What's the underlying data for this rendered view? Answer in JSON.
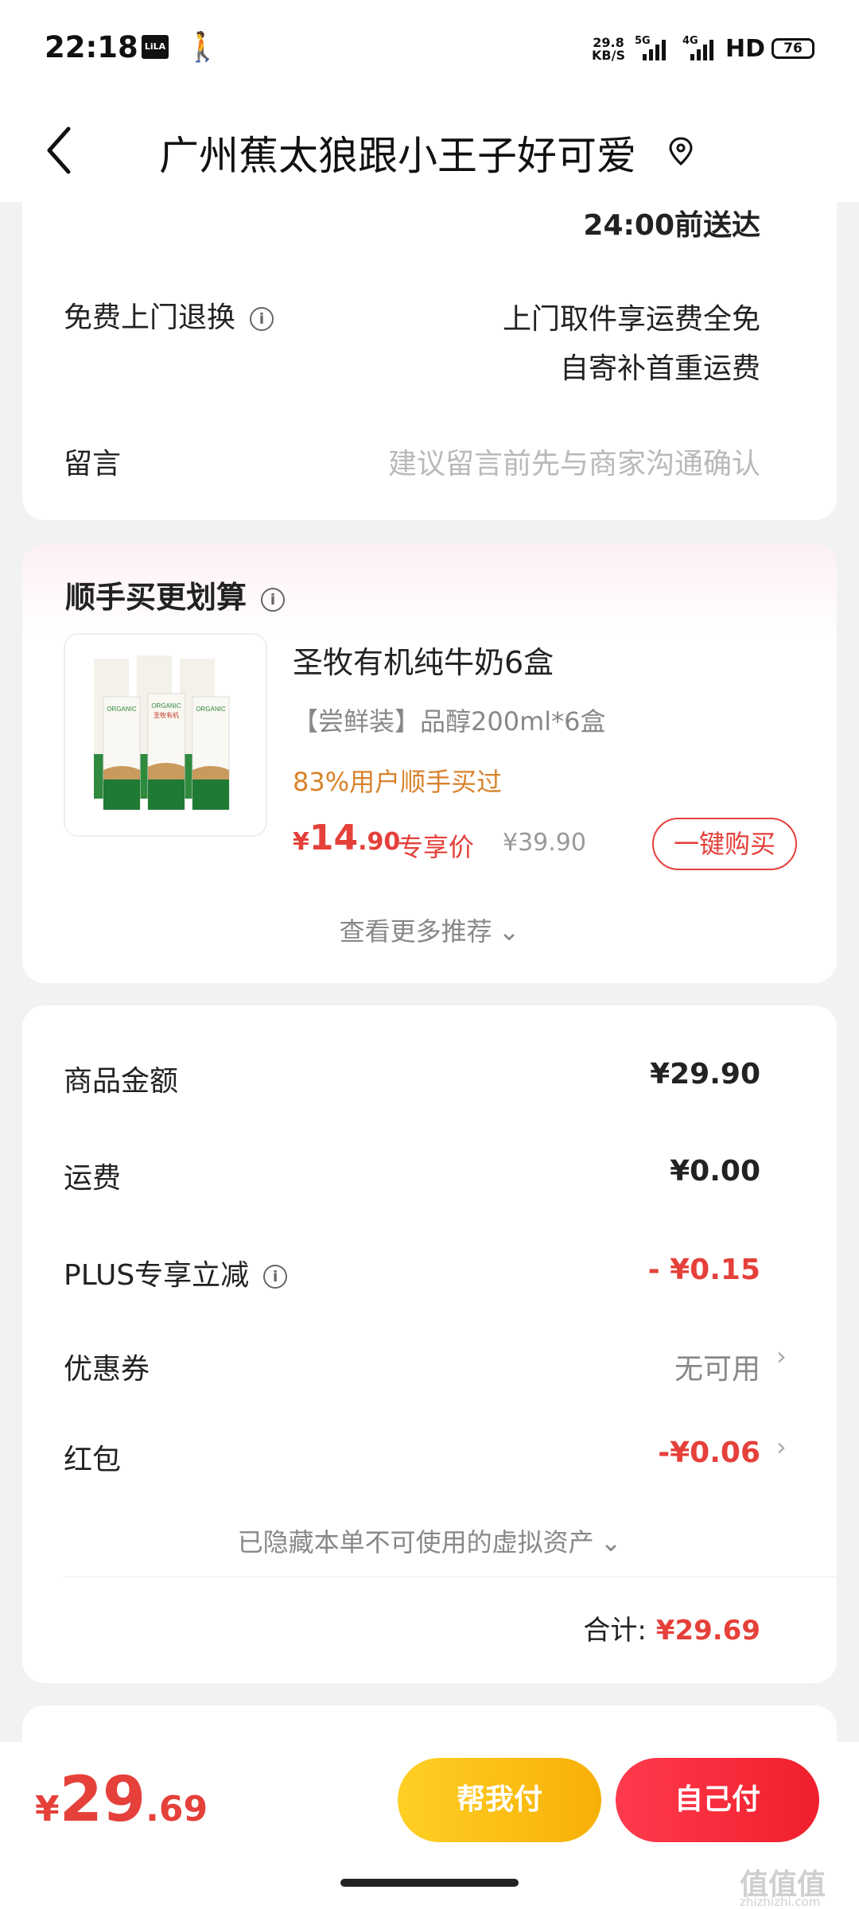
{
  "status_bar": {
    "time": "22:18",
    "app_icon_text": "LiLA",
    "net_speed_value": "29.8",
    "net_speed_unit": "KB/S",
    "network_1": "5G",
    "network_2": "4G",
    "hd_label": "HD",
    "battery": "76"
  },
  "nav": {
    "title": "广州蕉太狼跟小王子好可爱"
  },
  "delivery": {
    "deadline": "24:00前送达",
    "free_return_label": "免费上门退换",
    "free_return_line1": "上门取件享运费全免",
    "free_return_line2": "自寄补首重运费",
    "message_label": "留言",
    "message_placeholder": "建议留言前先与商家沟通确认"
  },
  "recommend": {
    "title": "顺手买更划算",
    "product_name": "圣牧有机纯牛奶6盒",
    "spec": "【尝鲜装】品醇200ml*6盒",
    "social_proof": "83%用户顺手买过",
    "price_symbol": "¥",
    "price_int": "14",
    "price_dec": ".90",
    "price_tag": "专享价",
    "orig_price": "¥39.90",
    "buy_button": "一键购买",
    "more_link": "查看更多推荐",
    "img_brand": "ORGANIC",
    "img_brand_cn": "圣牧有机"
  },
  "summary": {
    "rows": [
      {
        "label": "商品金额",
        "value": "¥29.90"
      },
      {
        "label": "运费",
        "value": "¥0.00"
      },
      {
        "label": "PLUS专享立减",
        "value": "- ¥0.15"
      },
      {
        "label": "优惠券",
        "value": "无可用"
      },
      {
        "label": "红包",
        "value": "-¥0.06"
      }
    ],
    "hidden_assets": "已隐藏本单不可使用的虚拟资产",
    "total_label": "合计:",
    "total_value": "¥29.69"
  },
  "bottom": {
    "price_symbol": "¥",
    "price_int": "29",
    "price_dec": ".69",
    "help_pay": "帮我付",
    "self_pay": "自己付",
    "watermark": "值值值",
    "watermark_url": "zhizhizhi.com"
  },
  "colors": {
    "accent_red": "#e5403a",
    "social_orange": "#d9822b",
    "help_yellow": "#f8b008"
  }
}
